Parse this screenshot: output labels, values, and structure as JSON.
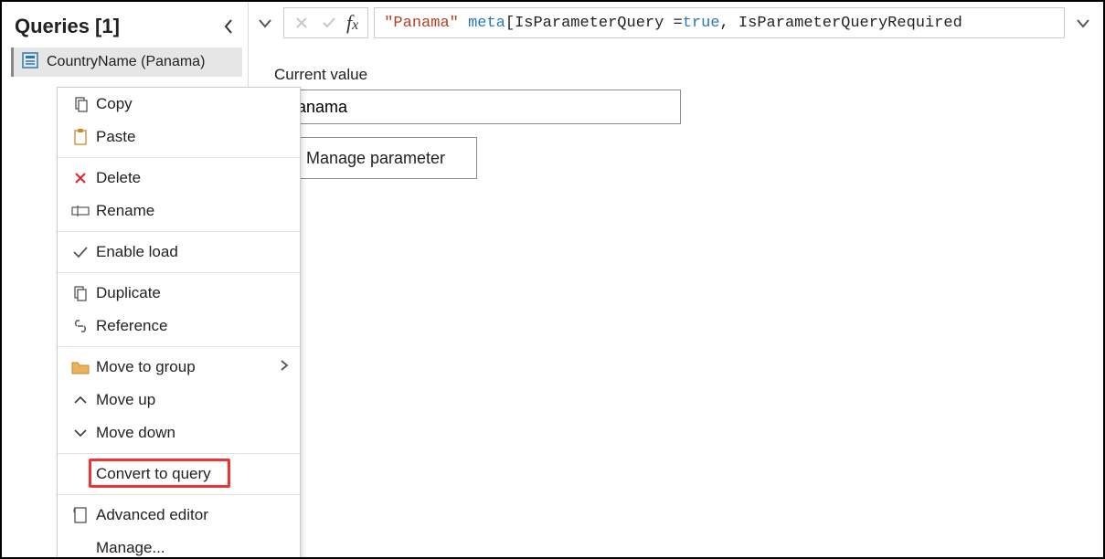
{
  "sidebar": {
    "title": "Queries [1]",
    "query_label": "CountryName (Panama)"
  },
  "formula": {
    "str": "\"Panama\"",
    "kw": "meta",
    "rest1": " [IsParameterQuery = ",
    "true": "true",
    "rest2": ", IsParameterQueryRequired"
  },
  "form": {
    "label": "Current value",
    "value": "Panama",
    "manage": "Manage parameter"
  },
  "menu": {
    "copy": "Copy",
    "paste": "Paste",
    "delete": "Delete",
    "rename": "Rename",
    "enable_load": "Enable load",
    "duplicate": "Duplicate",
    "reference": "Reference",
    "move_group": "Move to group",
    "move_up": "Move up",
    "move_down": "Move down",
    "convert": "Convert to query",
    "adv_editor": "Advanced editor",
    "manage": "Manage..."
  }
}
